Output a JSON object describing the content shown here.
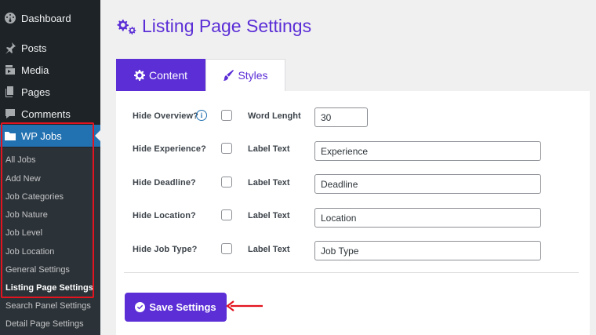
{
  "sidebar": {
    "menu": [
      {
        "label": "Dashboard",
        "icon": "dashboard-icon"
      },
      {
        "label": "Posts",
        "icon": "pin-icon"
      },
      {
        "label": "Media",
        "icon": "media-icon"
      },
      {
        "label": "Pages",
        "icon": "pages-icon"
      },
      {
        "label": "Comments",
        "icon": "comment-icon"
      },
      {
        "label": "WP Jobs",
        "icon": "folder-icon"
      }
    ],
    "submenu": [
      "All Jobs",
      "Add New",
      "Job Categories",
      "Job Nature",
      "Job Level",
      "Job Location",
      "General Settings",
      "Listing Page Settings",
      "Search Panel Settings",
      "Detail Page Settings"
    ]
  },
  "page": {
    "title": "Listing Page Settings",
    "tabs": [
      {
        "label": "Content",
        "icon": "gear-icon"
      },
      {
        "label": "Styles",
        "icon": "brush-icon"
      }
    ],
    "rows": [
      {
        "label": "Hide Overview?",
        "field_label": "Word Lenght",
        "value": "30",
        "info": "i"
      },
      {
        "label": "Hide Experience?",
        "field_label": "Label Text",
        "value": "Experience"
      },
      {
        "label": "Hide Deadline?",
        "field_label": "Label Text",
        "value": "Deadline"
      },
      {
        "label": "Hide Location?",
        "field_label": "Label Text",
        "value": "Location"
      },
      {
        "label": "Hide Job Type?",
        "field_label": "Label Text",
        "value": "Job Type"
      }
    ],
    "save_label": "Save Settings"
  },
  "colors": {
    "accent": "#5b2ed6",
    "sidebar_bg": "#1d2327",
    "active_menu": "#2271b1",
    "highlight": "#e3141f"
  }
}
